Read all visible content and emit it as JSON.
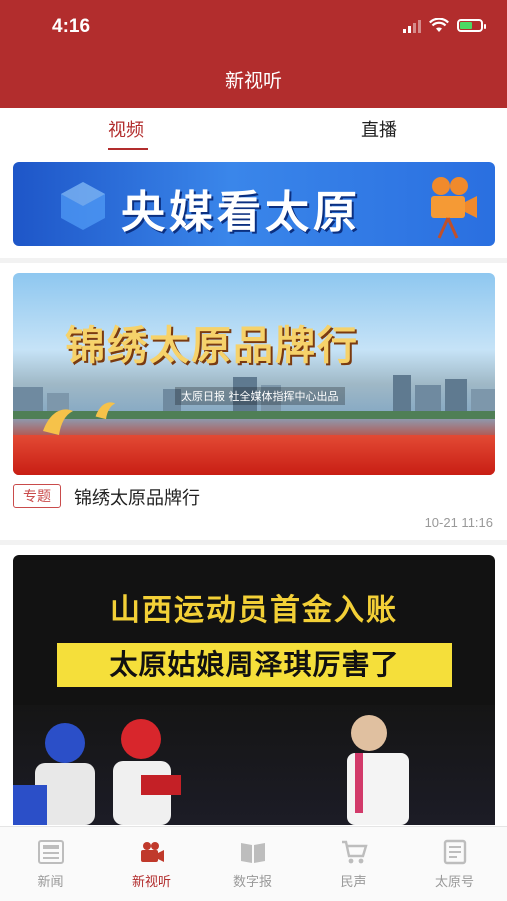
{
  "status_bar": {
    "time": "4:16"
  },
  "header": {
    "title": "新视听"
  },
  "tabs": [
    {
      "label": "视频",
      "active": true
    },
    {
      "label": "直播",
      "active": false
    }
  ],
  "banners": {
    "top": {
      "text": "央媒看太原"
    }
  },
  "feed": [
    {
      "image_title": "锦绣太原品牌行",
      "image_subtitle": "太原日报 社全媒体指挥中心出品",
      "tag": "专题",
      "title": "锦绣太原品牌行",
      "time": "10-21 11:16"
    },
    {
      "headline_line1": "山西运动员首金入账",
      "headline_line2": "太原姑娘周泽琪厉害了"
    }
  ],
  "tabbar": [
    {
      "label": "新闻",
      "icon": "newspaper-icon"
    },
    {
      "label": "新视听",
      "icon": "video-camera-icon",
      "active": true
    },
    {
      "label": "数字报",
      "icon": "book-icon"
    },
    {
      "label": "民声",
      "icon": "cart-icon"
    },
    {
      "label": "太原号",
      "icon": "document-icon"
    }
  ],
  "colors": {
    "brand_red": "#b22d2d",
    "active_tab": "#b22d2d",
    "muted": "#999999"
  }
}
